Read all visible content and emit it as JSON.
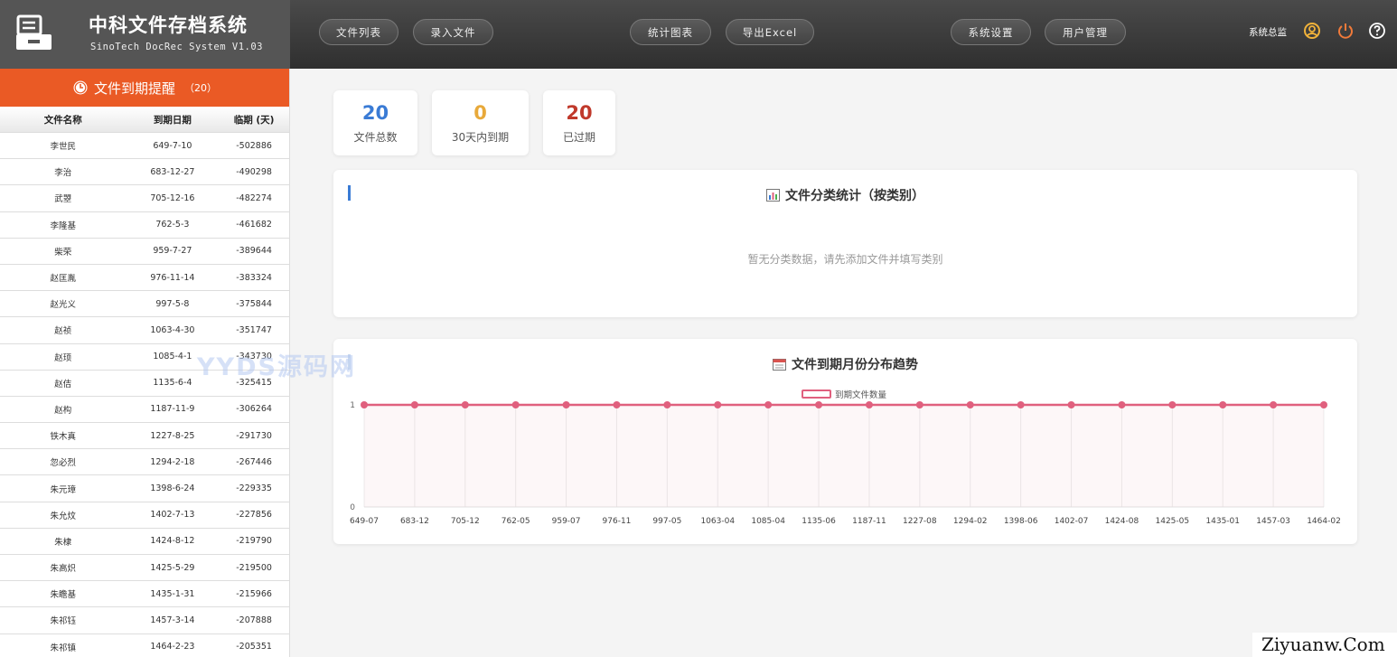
{
  "app": {
    "title": "中科文件存档系统",
    "subtitle": "SinoTech DocRec System V1.03"
  },
  "nav": {
    "items": [
      {
        "label": "文件列表"
      },
      {
        "label": "录入文件"
      },
      {
        "label": "统计图表"
      },
      {
        "label": "导出Excel"
      },
      {
        "label": "系统设置"
      },
      {
        "label": "用户管理"
      }
    ],
    "user_label": "系统总监",
    "icons": [
      "user-circle-icon",
      "power-icon",
      "help-icon"
    ],
    "power_color": "#f07a3a",
    "user_color": "#f0b23a"
  },
  "sidebar": {
    "title": "文件到期提醒",
    "count": "（20）",
    "header_color": "#ea5a25",
    "columns": [
      "文件名称",
      "到期日期",
      "临期 (天)"
    ],
    "rows": [
      {
        "name": "李世民",
        "date": "649-7-10",
        "days": "-502886"
      },
      {
        "name": "李治",
        "date": "683-12-27",
        "days": "-490298"
      },
      {
        "name": "武曌",
        "date": "705-12-16",
        "days": "-482274"
      },
      {
        "name": "李隆基",
        "date": "762-5-3",
        "days": "-461682"
      },
      {
        "name": "柴荣",
        "date": "959-7-27",
        "days": "-389644"
      },
      {
        "name": "赵匡胤",
        "date": "976-11-14",
        "days": "-383324"
      },
      {
        "name": "赵光义",
        "date": "997-5-8",
        "days": "-375844"
      },
      {
        "name": "赵祯",
        "date": "1063-4-30",
        "days": "-351747"
      },
      {
        "name": "赵顼",
        "date": "1085-4-1",
        "days": "-343730"
      },
      {
        "name": "赵佶",
        "date": "1135-6-4",
        "days": "-325415"
      },
      {
        "name": "赵构",
        "date": "1187-11-9",
        "days": "-306264"
      },
      {
        "name": "铁木真",
        "date": "1227-8-25",
        "days": "-291730"
      },
      {
        "name": "忽必烈",
        "date": "1294-2-18",
        "days": "-267446"
      },
      {
        "name": "朱元璋",
        "date": "1398-6-24",
        "days": "-229335"
      },
      {
        "name": "朱允炆",
        "date": "1402-7-13",
        "days": "-227856"
      },
      {
        "name": "朱棣",
        "date": "1424-8-12",
        "days": "-219790"
      },
      {
        "name": "朱高炽",
        "date": "1425-5-29",
        "days": "-219500"
      },
      {
        "name": "朱瞻基",
        "date": "1435-1-31",
        "days": "-215966"
      },
      {
        "name": "朱祁钰",
        "date": "1457-3-14",
        "days": "-207888"
      },
      {
        "name": "朱祁镇",
        "date": "1464-2-23",
        "days": "-205351"
      }
    ]
  },
  "stats": [
    {
      "value": "20",
      "label": "文件总数",
      "color": "#3a7bd5"
    },
    {
      "value": "0",
      "label": "30天内到期",
      "color": "#e8a93a"
    },
    {
      "value": "20",
      "label": "已过期",
      "color": "#c0392b"
    }
  ],
  "category_card": {
    "title": "文件分类统计（按类别）",
    "empty_message": "暂无分类数据，请先添加文件并填写类别"
  },
  "trend_card": {
    "title": "文件到期月份分布趋势"
  },
  "chart_data": {
    "type": "line",
    "title": "文件到期月份分布趋势",
    "categories": [
      "649-07",
      "683-12",
      "705-12",
      "762-05",
      "959-07",
      "976-11",
      "997-05",
      "1063-04",
      "1085-04",
      "1135-06",
      "1187-11",
      "1227-08",
      "1294-02",
      "1398-06",
      "1402-07",
      "1424-08",
      "1425-05",
      "1435-01",
      "1457-03",
      "1464-02"
    ],
    "series": [
      {
        "name": "到期文件数量",
        "values": [
          1,
          1,
          1,
          1,
          1,
          1,
          1,
          1,
          1,
          1,
          1,
          1,
          1,
          1,
          1,
          1,
          1,
          1,
          1,
          1
        ],
        "color": "#e0607e"
      }
    ],
    "yticks": [
      "0",
      "1"
    ],
    "ylim": [
      0,
      1
    ],
    "grid": true,
    "legend": "top-center"
  },
  "watermark": "YYDS源码网",
  "corner_text": "Ziyuanw.Com"
}
